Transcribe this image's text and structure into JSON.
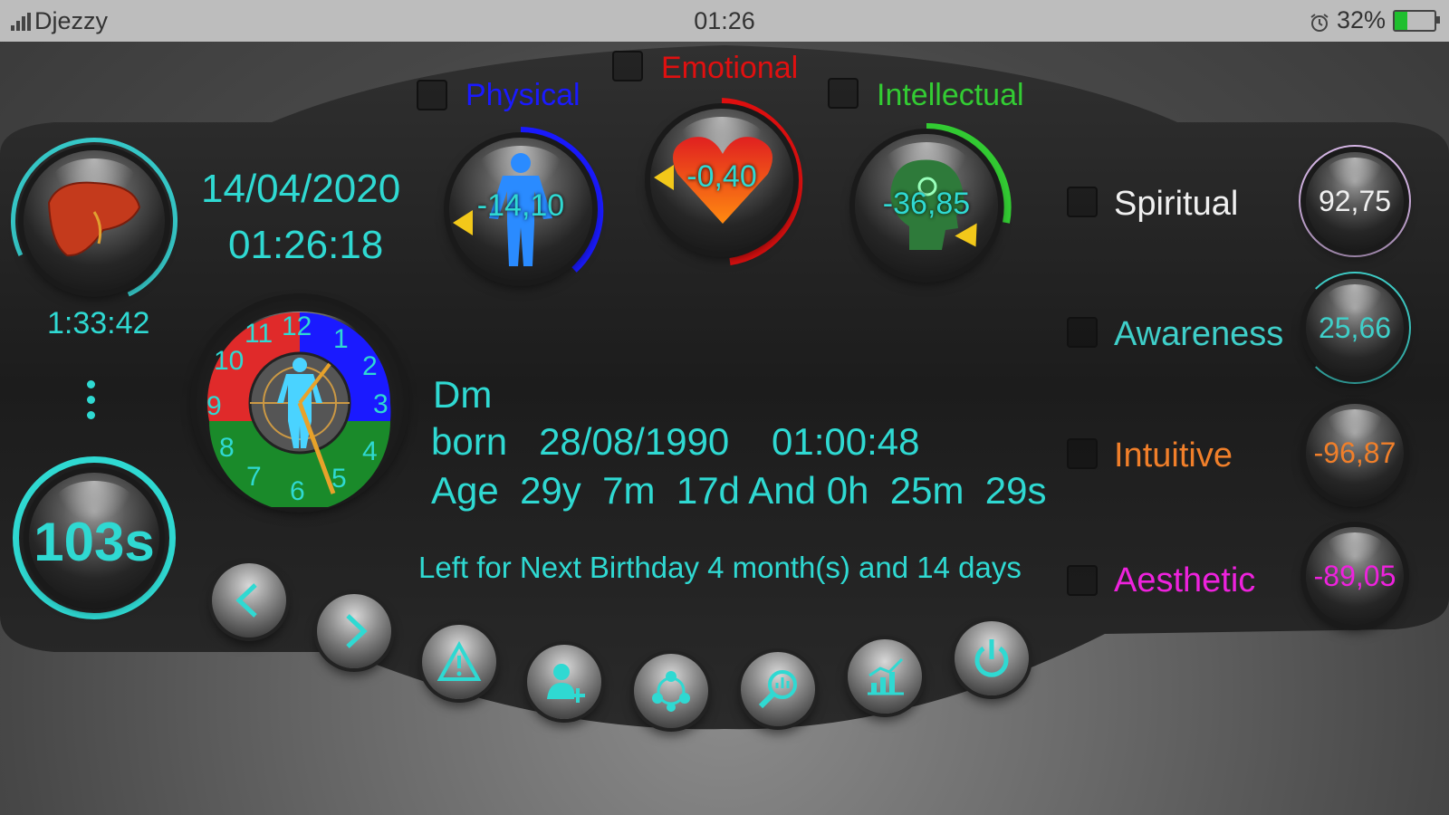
{
  "status_bar": {
    "carrier": "Djezzy",
    "time": "01:26",
    "battery": "32%",
    "battery_level": 0.32,
    "icons": [
      "signal-icon",
      "alarm-icon",
      "battery-charging-icon"
    ]
  },
  "clock": {
    "date": "14/04/2020",
    "time": "01:26:18"
  },
  "organ_timer": {
    "icon": "liver-icon",
    "value": "1:33:42"
  },
  "menu_icon": "more-vert-icon",
  "seconds_counter": "103s",
  "biorhythms": [
    {
      "label": "Physical",
      "value": "-14,10",
      "color": "#1a1aff",
      "icon": "body-icon"
    },
    {
      "label": "Emotional",
      "value": "-0,40",
      "color": "#e01010",
      "icon": "heart-icon"
    },
    {
      "label": "Intellectual",
      "value": "-36,85",
      "color": "#33cc33",
      "icon": "brain-icon"
    }
  ],
  "secondary_cycles": [
    {
      "label": "Spiritual",
      "value": "92,75",
      "color": "#f0f0f0",
      "ring": "#d8b8e8"
    },
    {
      "label": "Awareness",
      "value": "25,66",
      "color": "#3fcfc9",
      "ring": "#3fcfc9"
    },
    {
      "label": "Intuitive",
      "value": "-96,87",
      "color": "#f07f2a",
      "ring": "#f07f2a"
    },
    {
      "label": "Aesthetic",
      "value": "-89,05",
      "color": "#ee22dd",
      "ring": "#ee22dd"
    }
  ],
  "dial_numbers": [
    "12",
    "1",
    "2",
    "3",
    "4",
    "5",
    "6",
    "7",
    "8",
    "9",
    "10",
    "11"
  ],
  "person": {
    "name": "Dm",
    "born_label": "born",
    "birth_date": "28/08/1990",
    "birth_time": "01:00:48",
    "age_label": "Age",
    "age_y": "29y",
    "age_m": "7m",
    "age_d": "17d",
    "age_and": "And",
    "age_h": "0h",
    "age_min": "25m",
    "age_s": "29s",
    "next_birthday": "Left for Next Birthday 4 month(s) and 14 days"
  },
  "toolbar": [
    {
      "name": "previous-button",
      "icon": "chevron-left-icon"
    },
    {
      "name": "next-button",
      "icon": "chevron-right-icon"
    },
    {
      "name": "warning-button",
      "icon": "warning-icon"
    },
    {
      "name": "add-user-button",
      "icon": "add-user-icon"
    },
    {
      "name": "group-button",
      "icon": "group-icon"
    },
    {
      "name": "search-chart-button",
      "icon": "search-chart-icon"
    },
    {
      "name": "statistics-button",
      "icon": "bar-chart-icon"
    },
    {
      "name": "power-button",
      "icon": "power-icon"
    }
  ]
}
